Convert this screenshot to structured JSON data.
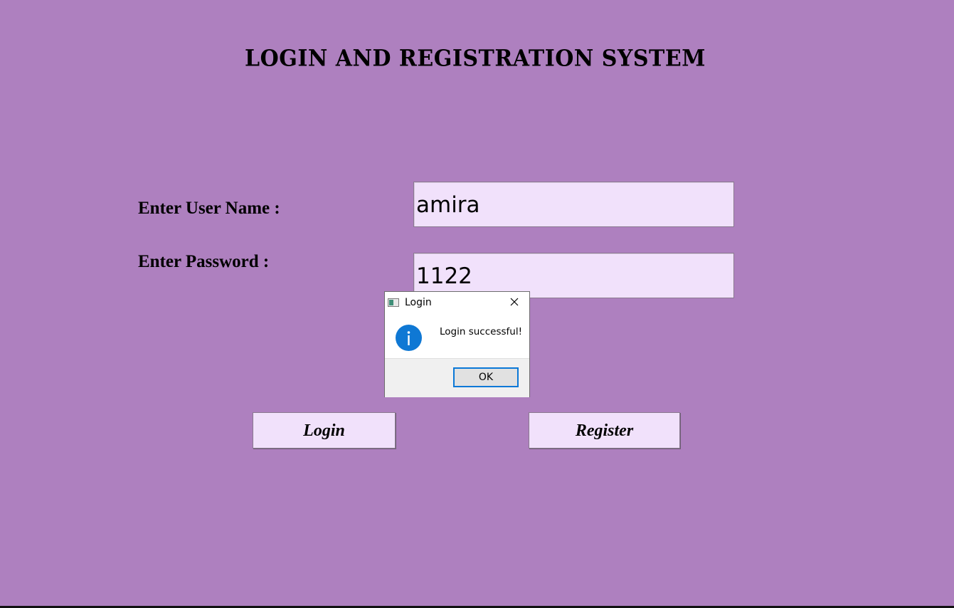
{
  "app": {
    "title": "LOGIN AND REGISTRATION SYSTEM",
    "background_color": "#ae80bf"
  },
  "form": {
    "username_label": "Enter User Name :",
    "username_value": "amira",
    "password_label": "Enter Password :",
    "password_value": "1122",
    "login_label": "Login",
    "register_label": "Register",
    "field_color": "#f1e1fb"
  },
  "dialog": {
    "title": "Login",
    "message": "Login successful!",
    "ok_label": "OK",
    "icon": "info-icon",
    "close_icon": "close-icon",
    "accent_color": "#0f78d4"
  }
}
